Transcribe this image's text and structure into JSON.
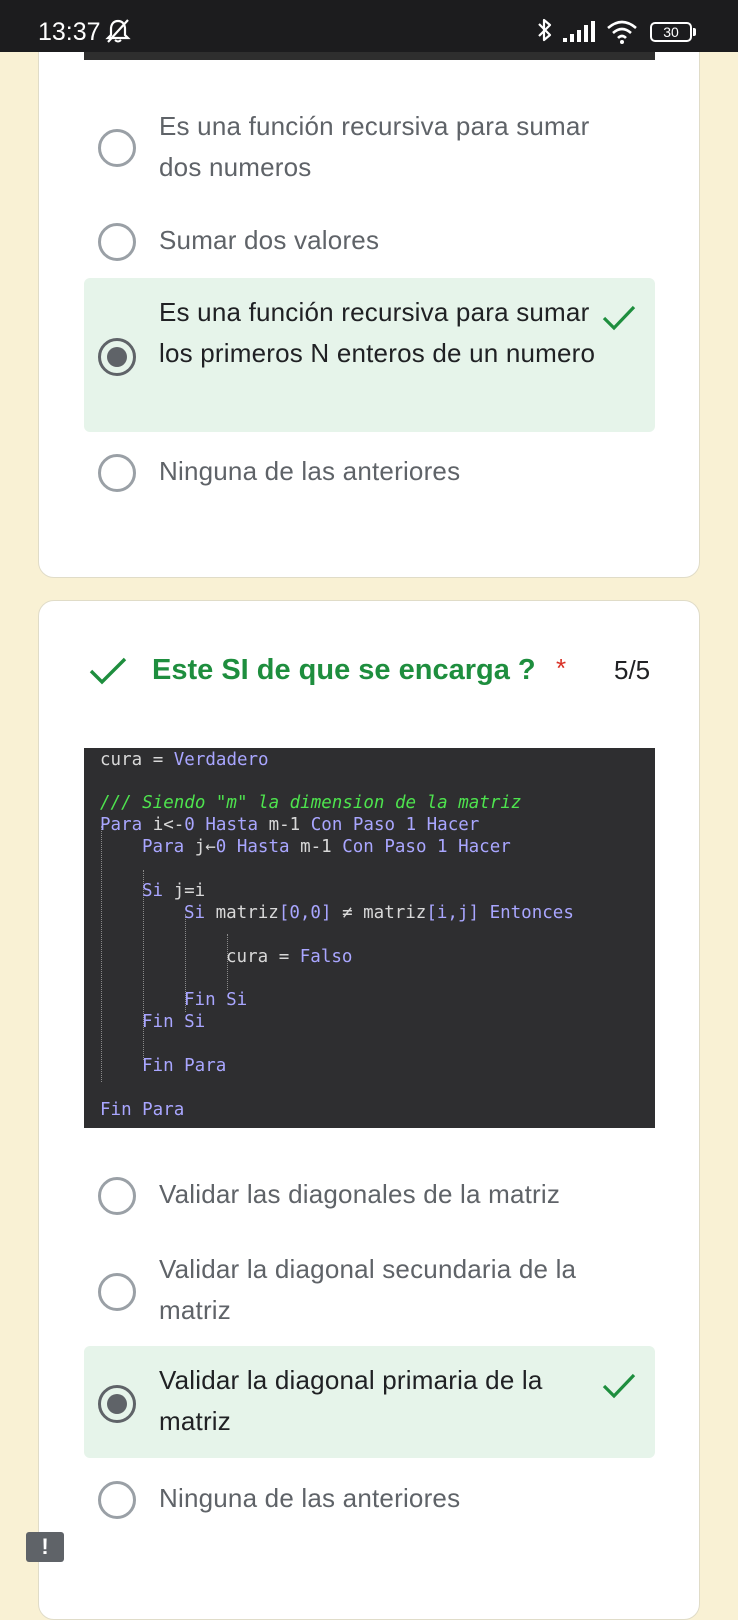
{
  "status_bar": {
    "time": "13:37",
    "battery": "30",
    "icons": [
      "bell-off-icon",
      "bluetooth-icon",
      "signal-icon",
      "wifi-icon",
      "battery-icon"
    ]
  },
  "question_prev": {
    "options": [
      {
        "label": "Es una función recursiva para sumar dos numeros",
        "selected": false,
        "correct": false
      },
      {
        "label": "Sumar dos valores",
        "selected": false,
        "correct": false
      },
      {
        "label": "Es una función recursiva para sumar los primeros N enteros de un numero",
        "selected": true,
        "correct": true
      },
      {
        "label": "Ninguna de las anteriores",
        "selected": false,
        "correct": false
      }
    ]
  },
  "question": {
    "title": "Este SI de que se encarga ?",
    "required_mark": "*",
    "score": "5/5",
    "code": [
      {
        "parts": [
          {
            "t": "cura ",
            "c": "w"
          },
          {
            "t": "= ",
            "c": "w"
          },
          {
            "t": "Verdadero",
            "c": "k"
          }
        ]
      },
      {
        "parts": [
          {
            "t": "/// Siendo \"m\" la dimension de la matriz",
            "c": "c"
          }
        ]
      },
      {
        "parts": [
          {
            "t": "Para ",
            "c": "k"
          },
          {
            "t": "i<-",
            "c": "w"
          },
          {
            "t": "0 ",
            "c": "k"
          },
          {
            "t": "Hasta ",
            "c": "k"
          },
          {
            "t": "m-1 ",
            "c": "w"
          },
          {
            "t": "Con Paso 1 Hacer",
            "c": "k"
          }
        ]
      },
      {
        "parts": [
          {
            "t": "Para ",
            "c": "k"
          },
          {
            "t": "j←",
            "c": "w"
          },
          {
            "t": "0 ",
            "c": "k"
          },
          {
            "t": "Hasta ",
            "c": "k"
          },
          {
            "t": "m-1 ",
            "c": "w"
          },
          {
            "t": "Con Paso 1 Hacer",
            "c": "k"
          }
        ]
      },
      {
        "parts": [
          {
            "t": "Si ",
            "c": "k"
          },
          {
            "t": "j=i",
            "c": "w"
          }
        ]
      },
      {
        "parts": [
          {
            "t": "Si ",
            "c": "k"
          },
          {
            "t": "matriz",
            "c": "w"
          },
          {
            "t": "[0,0]",
            "c": "k"
          },
          {
            "t": " ≠ matriz",
            "c": "w"
          },
          {
            "t": "[i,j]",
            "c": "k"
          },
          {
            "t": " Entonces",
            "c": "k"
          }
        ]
      },
      {
        "parts": [
          {
            "t": "cura ",
            "c": "w"
          },
          {
            "t": "= ",
            "c": "w"
          },
          {
            "t": "Falso",
            "c": "k"
          }
        ]
      },
      {
        "parts": [
          {
            "t": "Fin Si",
            "c": "k"
          }
        ]
      },
      {
        "parts": [
          {
            "t": "Fin Si",
            "c": "k"
          }
        ]
      },
      {
        "parts": [
          {
            "t": "Fin Para",
            "c": "k"
          }
        ]
      },
      {
        "parts": [
          {
            "t": "Fin Para",
            "c": "k"
          }
        ]
      }
    ],
    "options": [
      {
        "label": "Validar las diagonales de la matriz",
        "selected": false,
        "correct": false
      },
      {
        "label": "Validar la diagonal secundaria de la matriz",
        "selected": false,
        "correct": false
      },
      {
        "label": "Validar la diagonal primaria de la matriz",
        "selected": true,
        "correct": true
      },
      {
        "label": "Ninguna de las anteriores",
        "selected": false,
        "correct": false
      }
    ]
  },
  "feedback": {
    "label": "!"
  },
  "colors": {
    "background": "#f9f1d4",
    "correct_green": "#1e8e3e",
    "correct_bg": "#e6f4ea",
    "required_red": "#d93025",
    "code_bg": "#2e2e30",
    "code_keyword": "#a9a6ff",
    "code_comment": "#4ee34e"
  }
}
